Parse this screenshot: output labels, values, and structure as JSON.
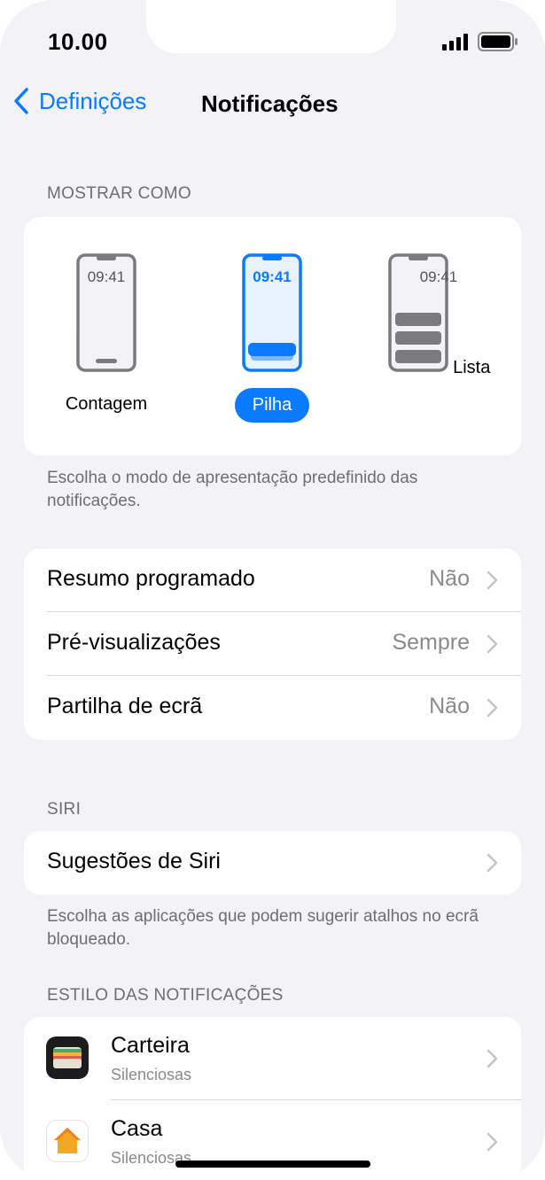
{
  "status": {
    "time": "10.00"
  },
  "nav": {
    "back_label": "Definições",
    "title": "Notificações"
  },
  "display_as": {
    "header": "MOSTRAR COMO",
    "options": [
      {
        "label": "Contagem",
        "time": "09:41",
        "selected": false
      },
      {
        "label": "Pilha",
        "time": "09:41",
        "selected": true
      },
      {
        "label": "Lista",
        "time": "09:41",
        "selected": false
      }
    ],
    "footer": "Escolha o modo de apresentação predefinido das notificações."
  },
  "settings": {
    "rows": [
      {
        "label": "Resumo programado",
        "value": "Não"
      },
      {
        "label": "Pré-visualizações",
        "value": "Sempre"
      },
      {
        "label": "Partilha de ecrã",
        "value": "Não"
      }
    ]
  },
  "siri": {
    "header": "SIRI",
    "row_label": "Sugestões de Siri",
    "footer": "Escolha as aplicações que podem sugerir atalhos no ecrã bloqueado."
  },
  "notification_style": {
    "header": "ESTILO DAS NOTIFICAÇÕES",
    "apps": [
      {
        "name": "Carteira",
        "subtitle": "Silenciosas",
        "icon": "wallet-app-icon"
      },
      {
        "name": "Casa",
        "subtitle": "Silenciosas",
        "icon": "home-app-icon"
      }
    ]
  },
  "colors": {
    "accent": "#0a7aff",
    "background": "#f2f2f7",
    "secondary_text": "#8a8a8e"
  }
}
